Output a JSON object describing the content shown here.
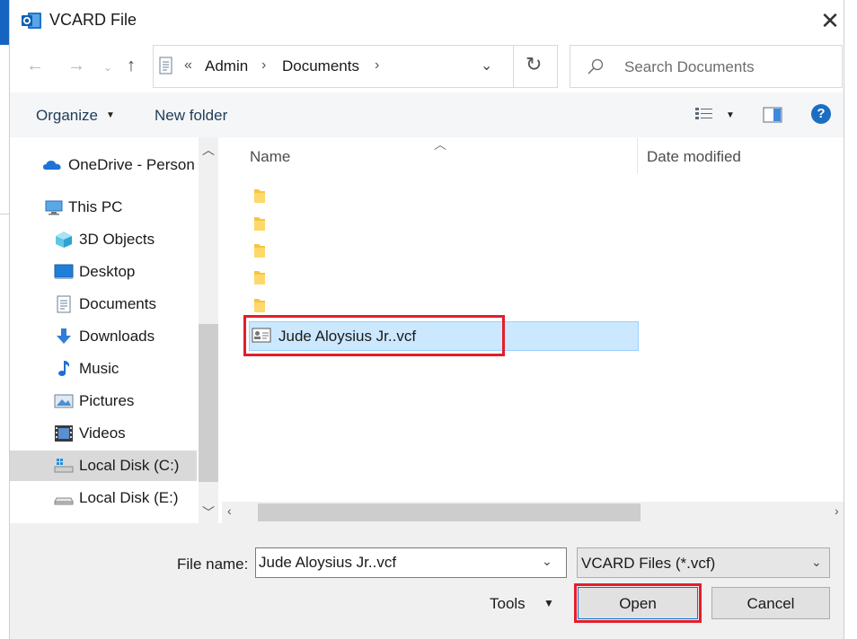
{
  "window": {
    "title": "VCARD File",
    "close_glyph": "✕",
    "app_icon": "outlook-icon"
  },
  "address": {
    "overflow_glyph": "«",
    "crumbs": [
      "Admin",
      "Documents"
    ],
    "search_placeholder": "Search Documents"
  },
  "toolbar": {
    "organize_label": "Organize",
    "new_folder_label": "New folder",
    "help_glyph": "?"
  },
  "nav": {
    "items": [
      {
        "label": "OneDrive - Person",
        "icon": "onedrive-cloud-icon"
      },
      {
        "label": "This PC",
        "icon": "this-pc-icon"
      },
      {
        "label": "3D Objects",
        "icon": "3d-objects-icon"
      },
      {
        "label": "Desktop",
        "icon": "desktop-icon"
      },
      {
        "label": "Documents",
        "icon": "documents-icon"
      },
      {
        "label": "Downloads",
        "icon": "downloads-icon"
      },
      {
        "label": "Music",
        "icon": "music-icon"
      },
      {
        "label": "Pictures",
        "icon": "pictures-icon"
      },
      {
        "label": "Videos",
        "icon": "videos-icon"
      },
      {
        "label": "Local Disk (C:)",
        "icon": "local-disk-c-icon",
        "selected": true
      },
      {
        "label": "Local Disk (E:)",
        "icon": "local-disk-e-icon"
      }
    ]
  },
  "files": {
    "columns": [
      "Name",
      "Date modified"
    ],
    "folders_count_note": "",
    "selected_file": "Jude Aloysius Jr..vcf"
  },
  "bottom": {
    "filename_label": "File name:",
    "filename_value": "Jude Aloysius Jr..vcf",
    "filter_value": "VCARD Files (*.vcf)",
    "tools_label": "Tools",
    "open_label": "Open",
    "cancel_label": "Cancel"
  },
  "colors": {
    "accent": "#0078d7",
    "highlight": "#e41e2b",
    "selection": "#cce8ff"
  }
}
